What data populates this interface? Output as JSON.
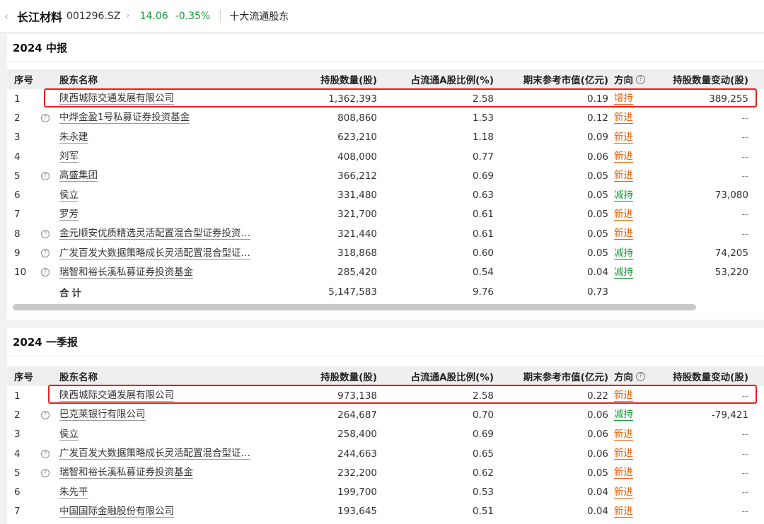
{
  "topbar": {
    "back_icon": "chevron-left-icon",
    "stock_name": "长江材料",
    "stock_code": "001296.SZ",
    "forward_icon": "chevron-right-icon",
    "price": "14.06",
    "change_pct": "-0.35%",
    "page_title": "十大流通股东",
    "price_color": "#1a9a3a"
  },
  "columns": {
    "idx": "序号",
    "name": "股东名称",
    "shares": "持股数量(股)",
    "ratio": "占流通A股比例(%)",
    "market_value": "期末参考市值(亿元)",
    "direction": "方向",
    "direction_help_icon": "question-circle-icon",
    "change": "持股数量变动(股)"
  },
  "colors": {
    "increase": "#e8620a",
    "decrease": "#1a9a3a",
    "highlight_box": "#e8201a"
  },
  "reports": [
    {
      "title": "2024 中报",
      "rows": [
        {
          "idx": "1",
          "fund": false,
          "name": "陕西城际交通发展有限公司",
          "shares": "1,362,393",
          "ratio": "2.58",
          "mv": "0.19",
          "dir": "增持",
          "dir_type": "inc",
          "chg": "389,255"
        },
        {
          "idx": "2",
          "fund": true,
          "name": "中烨金盈1号私募证券投资基金",
          "shares": "808,860",
          "ratio": "1.53",
          "mv": "0.12",
          "dir": "新进",
          "dir_type": "inc",
          "chg": "--"
        },
        {
          "idx": "3",
          "fund": false,
          "name": "朱永建",
          "shares": "623,210",
          "ratio": "1.18",
          "mv": "0.09",
          "dir": "新进",
          "dir_type": "inc",
          "chg": "--"
        },
        {
          "idx": "4",
          "fund": false,
          "name": "刘军",
          "shares": "408,000",
          "ratio": "0.77",
          "mv": "0.06",
          "dir": "新进",
          "dir_type": "inc",
          "chg": "--"
        },
        {
          "idx": "5",
          "fund": true,
          "name": "高盛集团",
          "shares": "366,212",
          "ratio": "0.69",
          "mv": "0.05",
          "dir": "新进",
          "dir_type": "inc",
          "chg": "--"
        },
        {
          "idx": "6",
          "fund": false,
          "name": "侯立",
          "shares": "331,480",
          "ratio": "0.63",
          "mv": "0.05",
          "dir": "减持",
          "dir_type": "dec",
          "chg": "73,080"
        },
        {
          "idx": "7",
          "fund": false,
          "name": "罗芳",
          "shares": "321,700",
          "ratio": "0.61",
          "mv": "0.05",
          "dir": "新进",
          "dir_type": "inc",
          "chg": "--"
        },
        {
          "idx": "8",
          "fund": true,
          "name": "金元顺安优质精选灵活配置混合型证券投资…",
          "shares": "321,440",
          "ratio": "0.61",
          "mv": "0.05",
          "dir": "新进",
          "dir_type": "inc",
          "chg": "--"
        },
        {
          "idx": "9",
          "fund": true,
          "name": "广发百发大数据策略成长灵活配置混合型证…",
          "shares": "318,868",
          "ratio": "0.60",
          "mv": "0.05",
          "dir": "减持",
          "dir_type": "dec",
          "chg": "74,205"
        },
        {
          "idx": "10",
          "fund": true,
          "name": "瑞智和裕长溪私募证券投资基金",
          "shares": "285,420",
          "ratio": "0.54",
          "mv": "0.04",
          "dir": "减持",
          "dir_type": "dec",
          "chg": "53,220"
        }
      ],
      "total": {
        "label": "合计",
        "shares": "5,147,583",
        "ratio": "9.76",
        "mv": "0.73"
      }
    },
    {
      "title": "2024 一季报",
      "rows": [
        {
          "idx": "1",
          "fund": false,
          "name": "陕西城际交通发展有限公司",
          "shares": "973,138",
          "ratio": "2.58",
          "mv": "0.22",
          "dir": "新进",
          "dir_type": "inc",
          "chg": "--"
        },
        {
          "idx": "2",
          "fund": true,
          "name": "巴克莱银行有限公司",
          "shares": "264,687",
          "ratio": "0.70",
          "mv": "0.06",
          "dir": "减持",
          "dir_type": "dec",
          "chg": "-79,421"
        },
        {
          "idx": "3",
          "fund": false,
          "name": "侯立",
          "shares": "258,400",
          "ratio": "0.69",
          "mv": "0.06",
          "dir": "新进",
          "dir_type": "inc",
          "chg": "--"
        },
        {
          "idx": "4",
          "fund": true,
          "name": "广发百发大数据策略成长灵活配置混合型证…",
          "shares": "244,663",
          "ratio": "0.65",
          "mv": "0.06",
          "dir": "新进",
          "dir_type": "inc",
          "chg": "--"
        },
        {
          "idx": "5",
          "fund": true,
          "name": "瑞智和裕长溪私募证券投资基金",
          "shares": "232,200",
          "ratio": "0.62",
          "mv": "0.05",
          "dir": "新进",
          "dir_type": "inc",
          "chg": "--"
        },
        {
          "idx": "6",
          "fund": false,
          "name": "朱先平",
          "shares": "199,700",
          "ratio": "0.53",
          "mv": "0.04",
          "dir": "新进",
          "dir_type": "inc",
          "chg": "--"
        },
        {
          "idx": "7",
          "fund": false,
          "name": "中国国际金融股份有限公司",
          "shares": "193,645",
          "ratio": "0.51",
          "mv": "0.04",
          "dir": "新进",
          "dir_type": "inc",
          "chg": "--"
        }
      ]
    }
  ]
}
